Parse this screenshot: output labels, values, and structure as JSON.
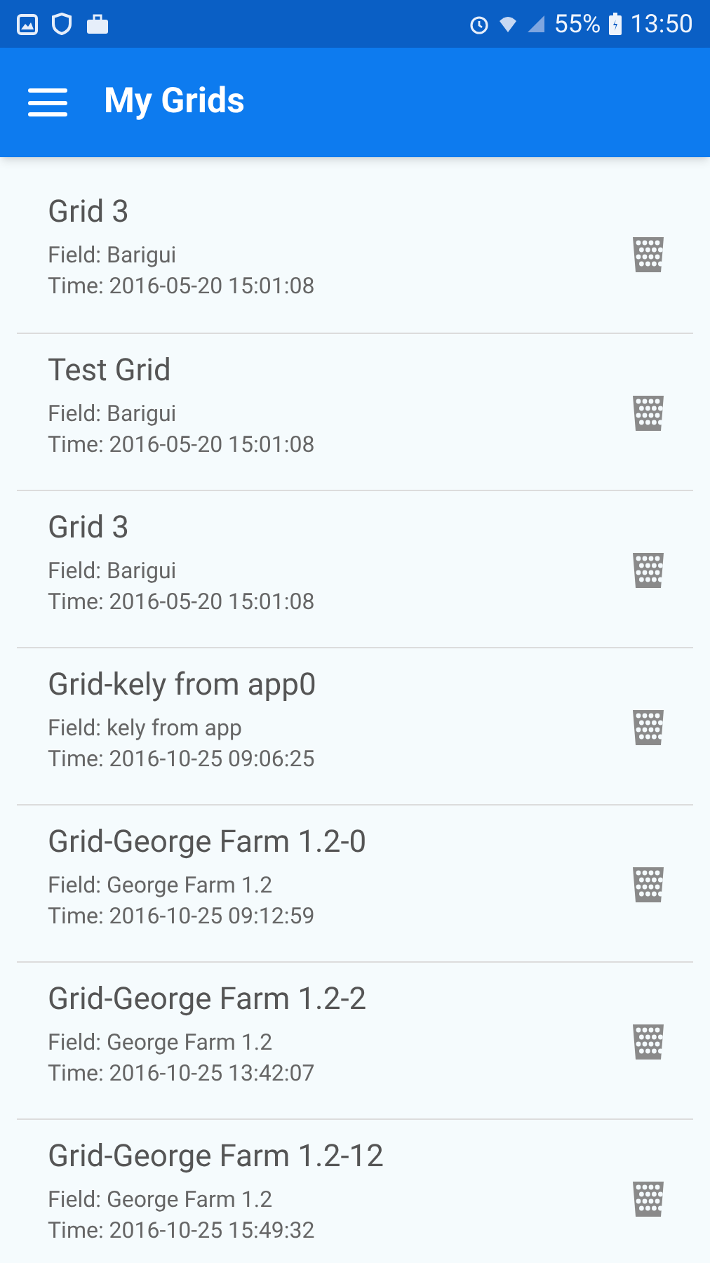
{
  "status_bar": {
    "battery": "55%",
    "time": "13:50"
  },
  "app_bar": {
    "title": "My Grids"
  },
  "grids": [
    {
      "name": "Grid 3",
      "field": "Field: Barigui",
      "time": "Time: 2016-05-20 15:01:08"
    },
    {
      "name": "Test Grid",
      "field": "Field: Barigui",
      "time": "Time: 2016-05-20 15:01:08"
    },
    {
      "name": "Grid 3",
      "field": "Field: Barigui",
      "time": "Time: 2016-05-20 15:01:08"
    },
    {
      "name": "Grid-kely from app0",
      "field": "Field: kely from app",
      "time": "Time: 2016-10-25 09:06:25"
    },
    {
      "name": "Grid-George Farm 1.2-0",
      "field": "Field: George Farm 1.2",
      "time": "Time: 2016-10-25 09:12:59"
    },
    {
      "name": "Grid-George Farm 1.2-2",
      "field": "Field: George Farm 1.2",
      "time": "Time: 2016-10-25 13:42:07"
    },
    {
      "name": "Grid-George Farm 1.2-12",
      "field": "Field: George Farm 1.2",
      "time": "Time: 2016-10-25 15:49:32"
    }
  ]
}
